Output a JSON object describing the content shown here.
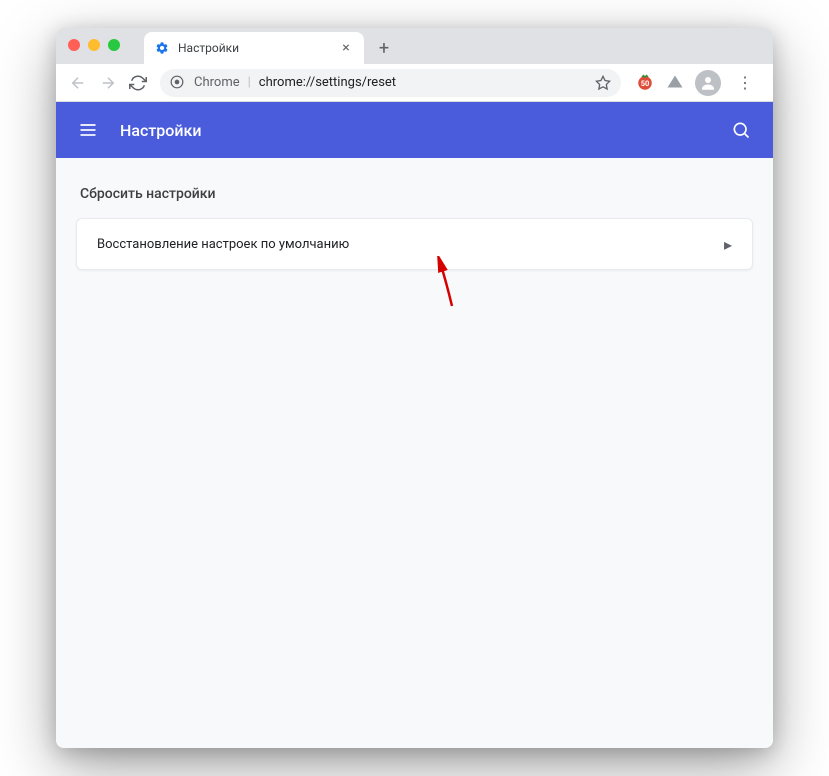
{
  "window": {
    "tab_title": "Настройки",
    "omnibox_label": "Chrome",
    "omnibox_url": "chrome://settings/reset"
  },
  "header": {
    "title": "Настройки"
  },
  "main": {
    "section_title": "Сбросить настройки",
    "restore_default_label": "Восстановление настроек по умолчанию"
  },
  "icons": {
    "close": "×",
    "plus": "+",
    "menu": "⋮",
    "chevron_right": "▸"
  }
}
